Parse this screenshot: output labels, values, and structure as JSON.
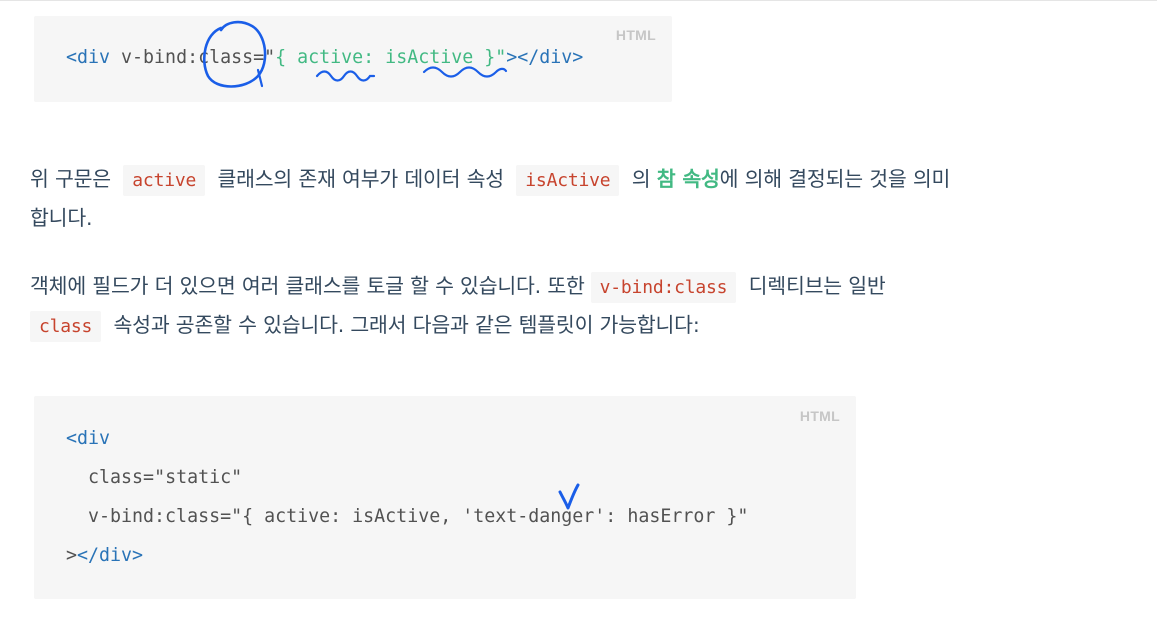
{
  "block1": {
    "lang": "HTML",
    "tokens": {
      "open": "<div",
      "attr": " v-bind:class=\"",
      "value": "{ active: isActive }",
      "close_quote": "\"",
      "close_tag": "></div>"
    }
  },
  "para1": {
    "line1": {
      "t1": "위 구문은",
      "c1": "active",
      "t2": "클래스의 존재 여부가 데이터 속성",
      "c2": "isActive",
      "t3": "의",
      "strong": "참 속성",
      "t4": "에 의해 결정되는 것을 의미"
    },
    "line2": "합니다."
  },
  "para2": {
    "line1": {
      "t1": "객체에 필드가 더 있으면 여러 클래스를 토글 할 수 있습니다. 또한",
      "c1": "v-bind:class",
      "t2": "디렉티브는 일반"
    },
    "line2": {
      "c1": "class",
      "t1": "속성과 공존할 수 있습니다. 그래서 다음과 같은 템플릿이 가능합니다:"
    }
  },
  "block2": {
    "lang": "HTML",
    "l1": {
      "tag": "<div"
    },
    "l2": {
      "attr": "  class=",
      "value": "\"static\""
    },
    "l3": {
      "attr": "  v-bind:class=",
      "value": "\"{ active: isActive, 'text-danger': hasError }\""
    },
    "l4": {
      "punct": ">",
      "tag": "</div>"
    }
  },
  "colors": {
    "code_tag": "#2973b7",
    "code_value": "#42b983",
    "inline_code": "#c7442e",
    "strong_text": "#42b983",
    "annotation_ink": "#1a5ee8"
  }
}
